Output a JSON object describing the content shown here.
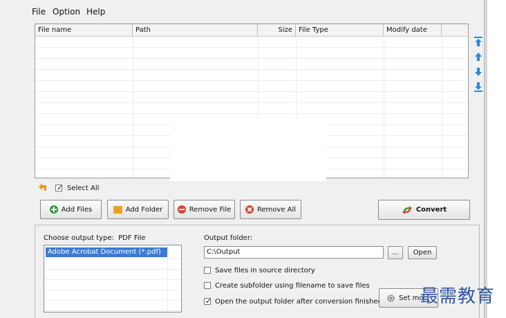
{
  "menu": {
    "items": [
      "File",
      "Option",
      "Help"
    ]
  },
  "file_table": {
    "columns": [
      "File name",
      "Path",
      "Size",
      "File Type",
      "Modify date"
    ],
    "rows": []
  },
  "select_all": {
    "label": "Select All",
    "checked": true
  },
  "buttons": {
    "add_files": "Add Files",
    "add_folder": "Add Folder",
    "remove_file": "Remove File",
    "remove_all": "Remove All",
    "convert": "Convert"
  },
  "output": {
    "type_label": "Choose output type:",
    "type_value": "PDF File",
    "type_list": [
      "Adobe Acrobat Document (*.pdf)"
    ],
    "folder_label": "Output folder:",
    "folder_value": "C:\\Output",
    "browse_label": "...",
    "open_label": "Open",
    "options": [
      {
        "label": "Save files in source directory",
        "checked": false
      },
      {
        "label": "Create subfolder using filename to save files",
        "checked": false
      },
      {
        "label": "Open the output folder after conversion finished",
        "checked": true
      }
    ],
    "set_more_label": "Set mo"
  },
  "watermark": "最需教育",
  "colors": {
    "selection": "#3a7bd5",
    "arrow_blue": "#2f86d6",
    "watermark": "#2f56a6"
  }
}
